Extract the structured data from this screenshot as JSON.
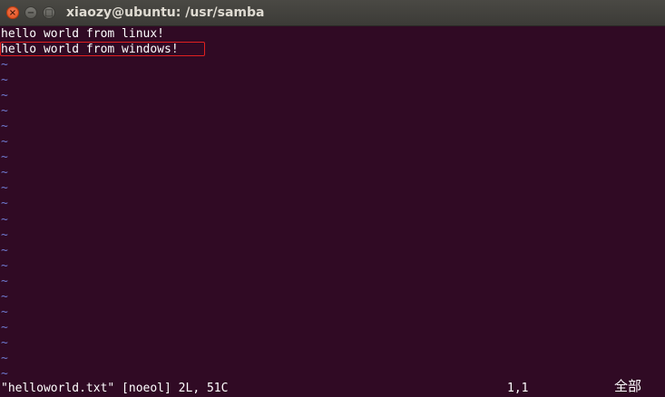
{
  "window": {
    "title": "xiaozy@ubuntu: /usr/samba",
    "close_glyph": "×",
    "minimize_glyph": "−",
    "maximize_glyph": "□"
  },
  "editor": {
    "lines": [
      "hello world from linux!",
      "hello world from windows!"
    ],
    "empty_line_marker": "~",
    "empty_line_count": 21,
    "highlighted_line": 2
  },
  "status": {
    "file_info": "\"helloworld.txt\" [noeol] 2L, 51C",
    "cursor_position": "1,1",
    "scroll_indicator": "全部"
  },
  "colors": {
    "background": "#300a24",
    "text": "#ffffff",
    "tilde": "#6e7ad0",
    "highlight_border": "#e02020",
    "close_button": "#df4a16"
  }
}
